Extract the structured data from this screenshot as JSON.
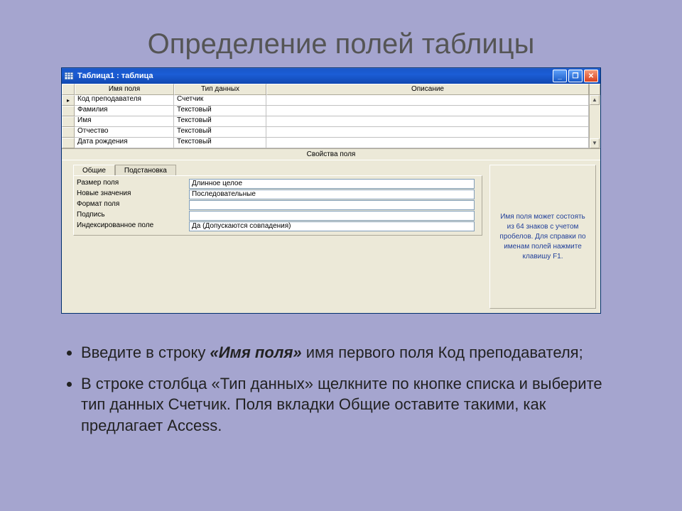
{
  "slide": {
    "title": "Определение полей таблицы"
  },
  "window": {
    "title": "Таблица1 : таблица"
  },
  "grid": {
    "headers": {
      "name": "Имя поля",
      "type": "Тип данных",
      "desc": "Описание"
    },
    "rows": [
      {
        "name": "Код преподавателя",
        "type": "Счетчик",
        "desc": ""
      },
      {
        "name": "Фамилия",
        "type": "Текстовый",
        "desc": ""
      },
      {
        "name": "Имя",
        "type": "Текстовый",
        "desc": ""
      },
      {
        "name": "Отчество",
        "type": "Текстовый",
        "desc": ""
      },
      {
        "name": "Дата рождения",
        "type": "Текстовый",
        "desc": ""
      }
    ]
  },
  "sectionHeader": "Свойства поля",
  "tabs": {
    "general": "Общие",
    "lookup": "Подстановка"
  },
  "props": [
    {
      "label": "Размер поля",
      "value": "Длинное целое"
    },
    {
      "label": "Новые значения",
      "value": "Последовательные"
    },
    {
      "label": "Формат поля",
      "value": ""
    },
    {
      "label": "Подпись",
      "value": ""
    },
    {
      "label": "Индексированное поле",
      "value": "Да (Допускаются совпадения)"
    }
  ],
  "hint": "Имя поля может состоять из 64 знаков с учетом пробелов. Для справки по именам полей нажмите клавишу F1.",
  "bullets": {
    "b1_pre": "Введите в строку ",
    "b1_em": "«Имя поля»",
    "b1_post": " имя первого поля Код преподавателя;",
    "b2": "В строке столбца «Тип данных» щелкните по кнопке списка и выберите тип данных Счетчик. Поля вкладки Общие оставите такими, как предлагает Access."
  }
}
